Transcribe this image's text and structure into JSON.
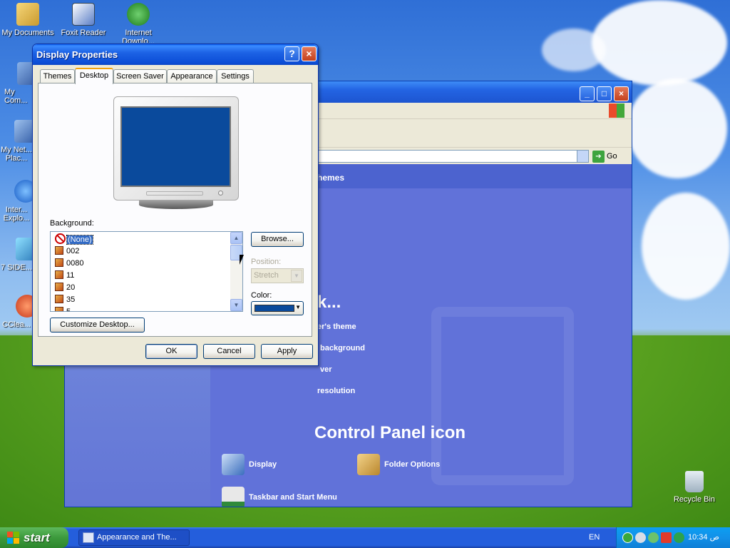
{
  "desktop": {
    "icons": [
      {
        "label": "My Documents"
      },
      {
        "label": "Foxit Reader"
      },
      {
        "label": "Internet Downlo..."
      },
      {
        "label": "My Com..."
      },
      {
        "label": "My Net... Plac..."
      },
      {
        "label": "Inter... Explo..."
      },
      {
        "label": "7 SIDE..."
      },
      {
        "label": "CClea..."
      },
      {
        "label": "Recycle Bin"
      }
    ]
  },
  "control_panel": {
    "address_go": "Go",
    "header_partial": "hemes",
    "pick_task_partial": "k...",
    "tasks": [
      "er's theme",
      "background",
      "ver",
      "resolution"
    ],
    "icon_heading_partial": "Control Panel icon",
    "items": [
      {
        "label": "Display",
        "icon": "display-icon"
      },
      {
        "label": "Folder Options",
        "icon": "folder-options-icon"
      },
      {
        "label": "Taskbar and Start Menu",
        "icon": "taskbar-icon"
      }
    ]
  },
  "dialog": {
    "title": "Display Properties",
    "tabs": [
      "Themes",
      "Desktop",
      "Screen Saver",
      "Appearance",
      "Settings"
    ],
    "active_tab": "Desktop",
    "background_label": "Background:",
    "backgrounds": [
      "(None)",
      "002",
      "0080",
      "11",
      "20",
      "35",
      "5"
    ],
    "selected_background": "(None)",
    "browse_label": "Browse...",
    "position_label": "Position:",
    "position_value": "Stretch",
    "color_label": "Color:",
    "color_value": "#0a4a9c",
    "customize_label": "Customize Desktop...",
    "ok_label": "OK",
    "cancel_label": "Cancel",
    "apply_label": "Apply"
  },
  "taskbar": {
    "start_label": "start",
    "task_item": "Appearance and The...",
    "language": "EN",
    "clock": "10:34 ص"
  }
}
